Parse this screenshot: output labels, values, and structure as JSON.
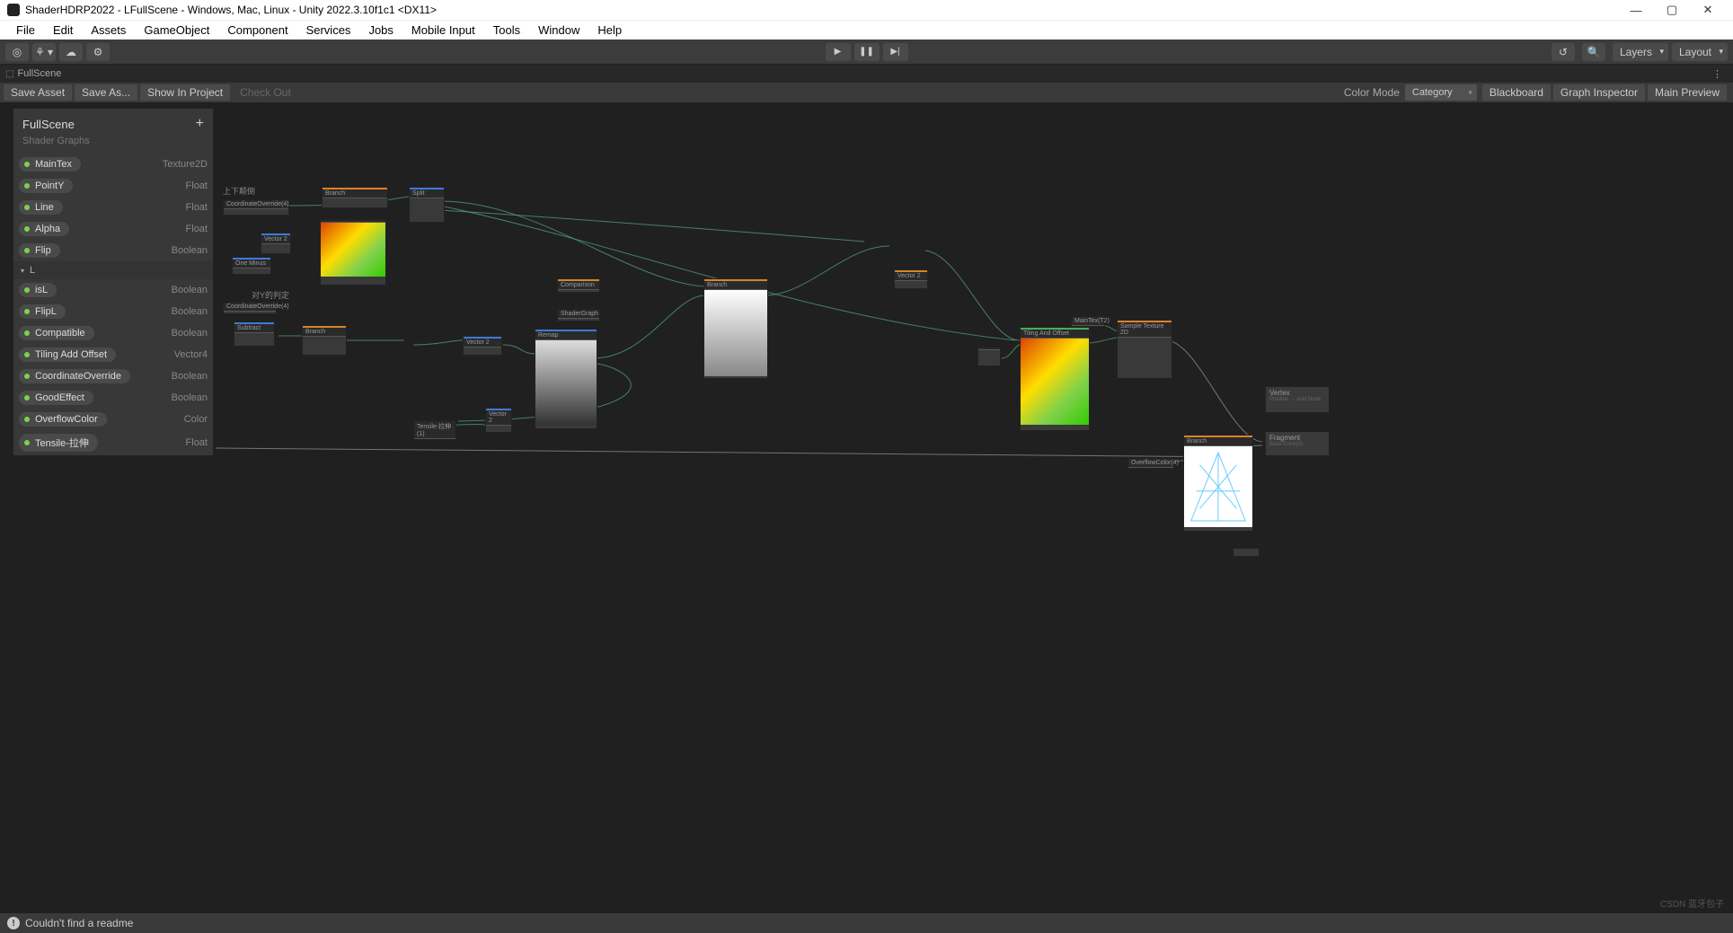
{
  "window": {
    "title": "ShaderHDRP2022 - LFullScene - Windows, Mac, Linux - Unity 2022.3.10f1c1 <DX11>",
    "min": "—",
    "max": "▢",
    "close": "✕"
  },
  "menubar": [
    "File",
    "Edit",
    "Assets",
    "GameObject",
    "Component",
    "Services",
    "Jobs",
    "Mobile Input",
    "Tools",
    "Window",
    "Help"
  ],
  "toolbar": {
    "account_icon": "◎",
    "picker": "⚘ ▾",
    "cloud": "☁",
    "settings": "⚙",
    "play": "▶",
    "pause": "❚❚",
    "step": "▶|",
    "undo": "↺",
    "search": "🔍",
    "layers": "Layers",
    "layout": "Layout"
  },
  "tab": {
    "icon": "⬚",
    "name": "FullScene",
    "dots": "⋮"
  },
  "subbar": {
    "save": "Save Asset",
    "saveas": "Save As...",
    "show": "Show In Project",
    "checkout": "Check Out",
    "colormode_label": "Color Mode",
    "colormode_value": "Category",
    "blackboard": "Blackboard",
    "graphinspector": "Graph Inspector",
    "mainpreview": "Main Preview"
  },
  "blackboard": {
    "title": "FullScene",
    "subtitle": "Shader Graphs",
    "plus": "+",
    "props": [
      {
        "name": "MainTex",
        "type": "Texture2D"
      },
      {
        "name": "PointY",
        "type": "Float"
      },
      {
        "name": "Line",
        "type": "Float"
      },
      {
        "name": "Alpha",
        "type": "Float"
      },
      {
        "name": "Flip",
        "type": "Boolean"
      }
    ],
    "category": "L",
    "props2": [
      {
        "name": "isL",
        "type": "Boolean"
      },
      {
        "name": "FlipL",
        "type": "Boolean"
      },
      {
        "name": "Compatible",
        "type": "Boolean"
      },
      {
        "name": "Tiling Add Offset",
        "type": "Vector4"
      },
      {
        "name": "CoordinateOverride",
        "type": "Boolean"
      },
      {
        "name": "GoodEffect",
        "type": "Boolean"
      },
      {
        "name": "OverflowColor",
        "type": "Color"
      },
      {
        "name": "Tensile-拉伸",
        "type": "Float"
      }
    ]
  },
  "notes": {
    "n1": "上下颠倒",
    "n2": "对Y的判定"
  },
  "nodes": {
    "coordoverride": "CoordinateOverride(4)",
    "branch": "Branch",
    "split": "Split",
    "vector2": "Vector 2",
    "oneminus": "One Minus",
    "subtract": "Subtract",
    "comparison": "Comparison",
    "shadergraph": "ShaderGraph",
    "remap": "Remap",
    "tensile": "Tensile-拉伸(1)",
    "tilingoffset": "Tiling And Offset",
    "maintex": "MainTex(T2)",
    "sampletex": "Sample Texture 2D",
    "vertex": "Vertex",
    "fragment": "Fragment",
    "position": "Position",
    "basecolor": "Base Color(3)"
  },
  "status": {
    "msg": "Couldn't find a readme"
  },
  "watermark": "CSDN 蓝牙包子"
}
